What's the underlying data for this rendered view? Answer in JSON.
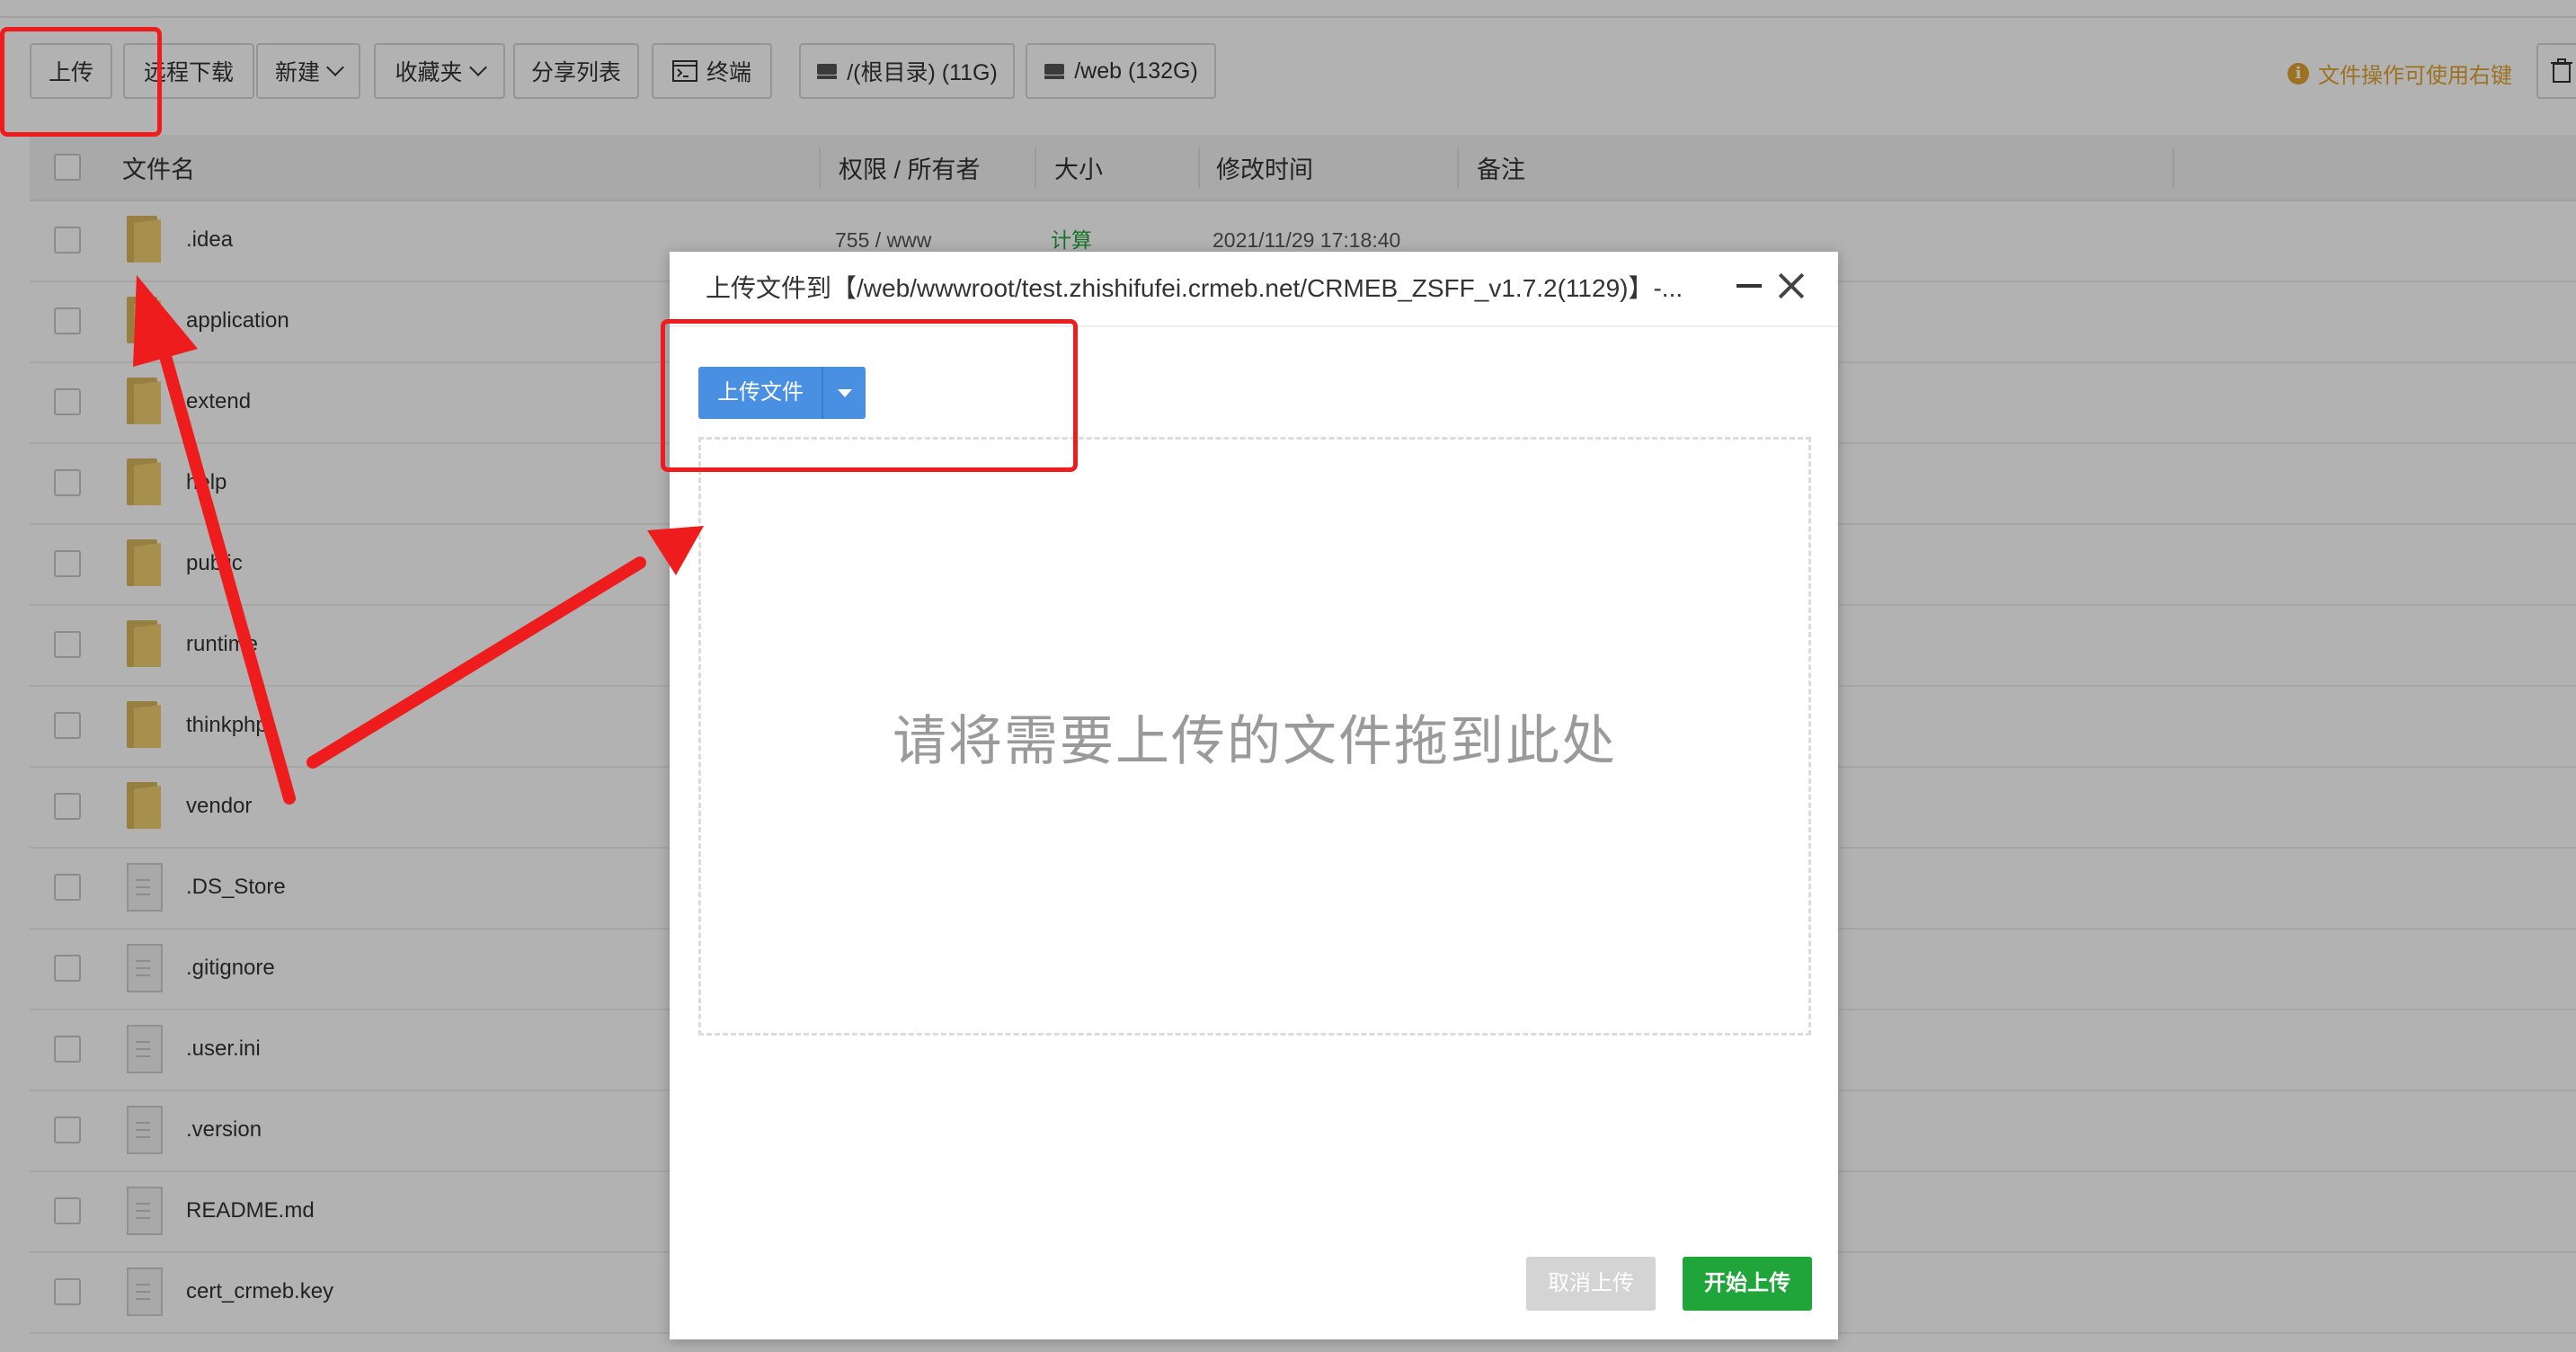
{
  "toolbar": {
    "buttons": [
      {
        "label": "上传"
      },
      {
        "label": "远程下载"
      },
      {
        "label": "新建"
      },
      {
        "label": "收藏夹"
      },
      {
        "label": "分享列表"
      },
      {
        "label": "终端"
      },
      {
        "label": "/(根目录) (11G)"
      },
      {
        "label": "/web (132G)"
      }
    ],
    "hint": "文件操作可使用右键"
  },
  "table": {
    "headers": {
      "name": "文件名",
      "perm": "权限 / 所有者",
      "size": "大小",
      "mtime": "修改时间",
      "note": "备注"
    },
    "rows": [
      {
        "name": ".idea",
        "type": "folder",
        "perm": "755 / www",
        "size": "计算",
        "mtime": "2021/11/29 17:18:40"
      },
      {
        "name": "application",
        "type": "folder"
      },
      {
        "name": "extend",
        "type": "folder"
      },
      {
        "name": "help",
        "type": "folder"
      },
      {
        "name": "public",
        "type": "folder"
      },
      {
        "name": "runtime",
        "type": "folder"
      },
      {
        "name": "thinkphp",
        "type": "folder"
      },
      {
        "name": "vendor",
        "type": "folder"
      },
      {
        "name": ".DS_Store",
        "type": "file"
      },
      {
        "name": ".gitignore",
        "type": "file"
      },
      {
        "name": ".user.ini",
        "type": "file"
      },
      {
        "name": ".version",
        "type": "file"
      },
      {
        "name": "README.md",
        "type": "file"
      },
      {
        "name": "cert_crmeb.key",
        "type": "file"
      }
    ]
  },
  "modal": {
    "title": "上传文件到【/web/wwwroot/test.zhishifufei.crmeb.net/CRMEB_ZSFF_v1.7.2(1129)】-...",
    "upload_button": "上传文件",
    "dropzone_text": "请将需要上传的文件拖到此处",
    "cancel_button": "取消上传",
    "start_button": "开始上传"
  },
  "colors": {
    "primary_blue": "#4a90e2",
    "success_green": "#20a53a",
    "hint_orange": "#e0a32e",
    "annotation_red": "#ee1c1c"
  }
}
